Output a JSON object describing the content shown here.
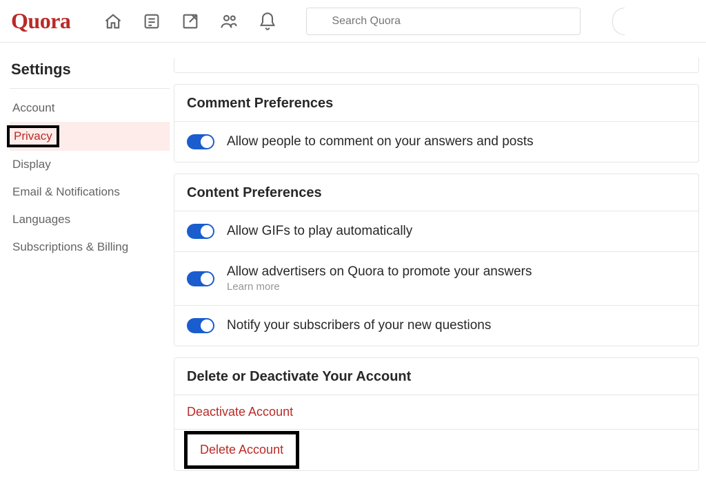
{
  "logo_text": "Quora",
  "search": {
    "placeholder": "Search Quora"
  },
  "sidebar": {
    "title": "Settings",
    "items": [
      {
        "label": "Account"
      },
      {
        "label": "Privacy"
      },
      {
        "label": "Display"
      },
      {
        "label": "Email & Notifications"
      },
      {
        "label": "Languages"
      },
      {
        "label": "Subscriptions & Billing"
      }
    ]
  },
  "sections": {
    "comment": {
      "title": "Comment Preferences",
      "allow_comments": "Allow people to comment on your answers and posts"
    },
    "content": {
      "title": "Content Preferences",
      "allow_gifs": "Allow GIFs to play automatically",
      "allow_ads": "Allow advertisers on Quora to promote your answers",
      "learn_more": "Learn more",
      "notify_subs": "Notify your subscribers of your new questions"
    },
    "delete": {
      "title": "Delete or Deactivate Your Account",
      "deactivate": "Deactivate Account",
      "delete": "Delete Account"
    }
  }
}
